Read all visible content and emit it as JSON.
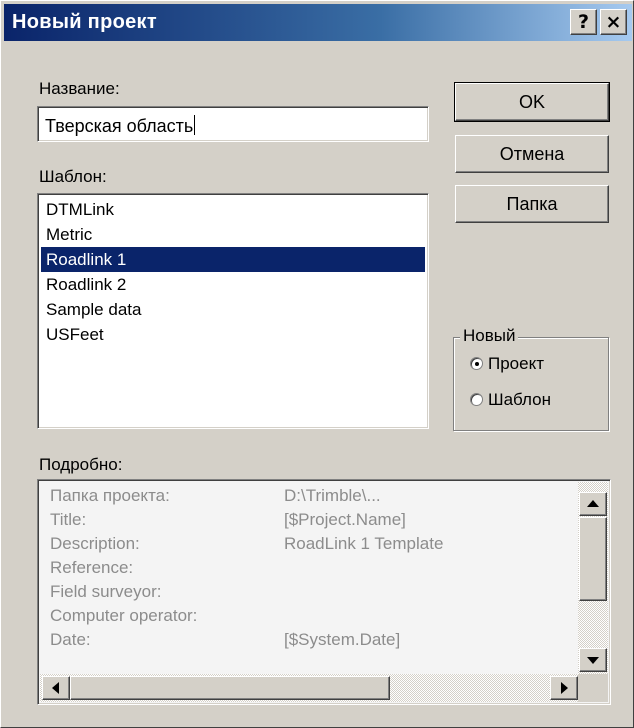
{
  "window": {
    "title": "Новый проект",
    "help_glyph": "?",
    "close_glyph": "×"
  },
  "name_field": {
    "label": "Название:",
    "value": "Тверская область"
  },
  "template_list": {
    "label": "Шаблон:",
    "items": [
      "DTMLink",
      "Metric",
      "Roadlink 1",
      "Roadlink 2",
      "Sample data",
      "USFeet"
    ],
    "selected": "Roadlink 1"
  },
  "buttons": {
    "ok": "OK",
    "cancel": "Отмена",
    "folder": "Папка"
  },
  "new_group": {
    "label": "Новый",
    "options": [
      "Проект",
      "Шаблон"
    ],
    "selected": "Проект"
  },
  "details": {
    "label": "Подробно:",
    "rows": [
      {
        "key": "Папка проекта:",
        "value": "D:\\Trimble\\..."
      },
      {
        "key": "Title:",
        "value": "[$Project.Name]"
      },
      {
        "key": "Description:",
        "value": "RoadLink 1 Template"
      },
      {
        "key": "Reference:",
        "value": ""
      },
      {
        "key": "Field surveyor:",
        "value": ""
      },
      {
        "key": "Computer operator:",
        "value": ""
      },
      {
        "key": "Date:",
        "value": "[$System.Date]"
      }
    ]
  },
  "colors": {
    "title_gradient_start": "#0a246a",
    "title_gradient_end": "#a6caf0",
    "selection": "#0a246a",
    "dialog_face": "#d4d0c8",
    "details_text": "#8c8c8c"
  },
  "icons": {
    "help": "help-icon",
    "close": "close-icon",
    "scroll_up": "arrow-up-icon",
    "scroll_down": "arrow-down-icon",
    "scroll_left": "arrow-left-icon",
    "scroll_right": "arrow-right-icon"
  }
}
